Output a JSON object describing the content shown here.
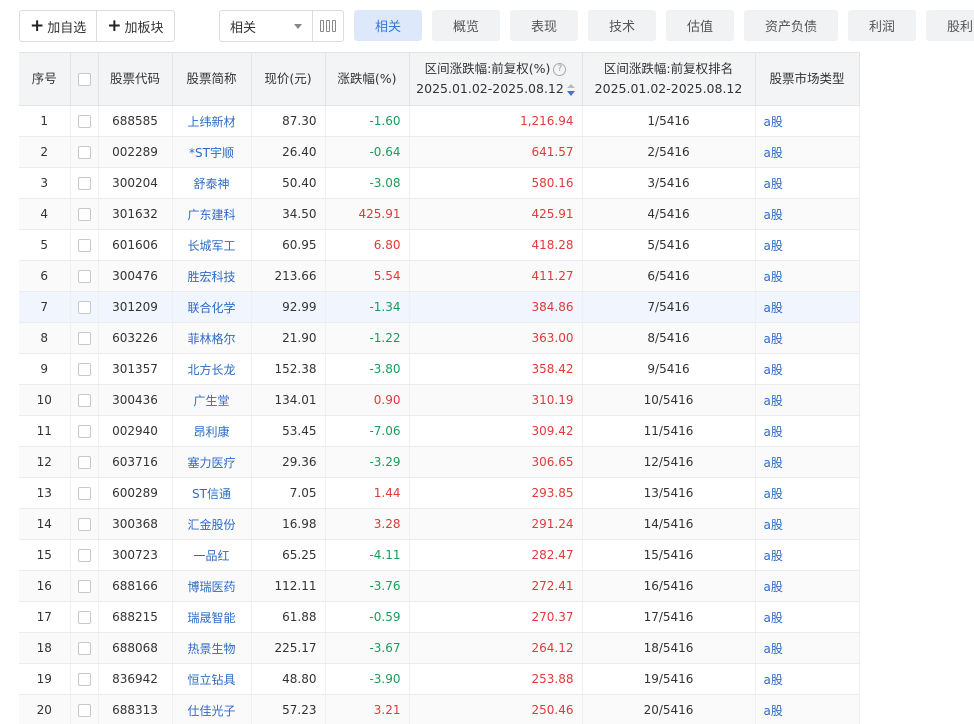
{
  "toolbar": {
    "add_watch_label": "加自选",
    "add_sector_label": "加板块",
    "select_value": "相关",
    "tabs": [
      {
        "label": "相关",
        "active": true
      },
      {
        "label": "概览",
        "active": false
      },
      {
        "label": "表现",
        "active": false
      },
      {
        "label": "技术",
        "active": false
      },
      {
        "label": "估值",
        "active": false
      },
      {
        "label": "资产负债",
        "active": false
      },
      {
        "label": "利润",
        "active": false
      },
      {
        "label": "股利",
        "active": false
      }
    ]
  },
  "table": {
    "headers": {
      "idx": "序号",
      "code": "股票代码",
      "name": "股票简称",
      "price": "现价(元)",
      "chg": "涨跌幅(%)",
      "range_line1": "区间涨跌幅:前复权(%)",
      "range_line2": "2025.01.02-2025.08.12",
      "rank_line1": "区间涨跌幅:前复权排名",
      "rank_line2": "2025.01.02-2025.08.12",
      "market": "股票市场类型"
    },
    "rows": [
      {
        "idx": "1",
        "code": "688585",
        "name": "上纬新材",
        "price": "87.30",
        "chg": "-1.60",
        "dir": "down",
        "range": "1,216.94",
        "rank": "1/5416",
        "market": "a股"
      },
      {
        "idx": "2",
        "code": "002289",
        "name": "*ST宇顺",
        "price": "26.40",
        "chg": "-0.64",
        "dir": "down",
        "range": "641.57",
        "rank": "2/5416",
        "market": "a股"
      },
      {
        "idx": "3",
        "code": "300204",
        "name": "舒泰神",
        "price": "50.40",
        "chg": "-3.08",
        "dir": "down",
        "range": "580.16",
        "rank": "3/5416",
        "market": "a股"
      },
      {
        "idx": "4",
        "code": "301632",
        "name": "广东建科",
        "price": "34.50",
        "chg": "425.91",
        "dir": "up",
        "range": "425.91",
        "rank": "4/5416",
        "market": "a股"
      },
      {
        "idx": "5",
        "code": "601606",
        "name": "长城军工",
        "price": "60.95",
        "chg": "6.80",
        "dir": "up",
        "range": "418.28",
        "rank": "5/5416",
        "market": "a股"
      },
      {
        "idx": "6",
        "code": "300476",
        "name": "胜宏科技",
        "price": "213.66",
        "chg": "5.54",
        "dir": "up",
        "range": "411.27",
        "rank": "6/5416",
        "market": "a股"
      },
      {
        "idx": "7",
        "code": "301209",
        "name": "联合化学",
        "price": "92.99",
        "chg": "-1.34",
        "dir": "down",
        "range": "384.86",
        "rank": "7/5416",
        "market": "a股"
      },
      {
        "idx": "8",
        "code": "603226",
        "name": "菲林格尔",
        "price": "21.90",
        "chg": "-1.22",
        "dir": "down",
        "range": "363.00",
        "rank": "8/5416",
        "market": "a股"
      },
      {
        "idx": "9",
        "code": "301357",
        "name": "北方长龙",
        "price": "152.38",
        "chg": "-3.80",
        "dir": "down",
        "range": "358.42",
        "rank": "9/5416",
        "market": "a股"
      },
      {
        "idx": "10",
        "code": "300436",
        "name": "广生堂",
        "price": "134.01",
        "chg": "0.90",
        "dir": "up",
        "range": "310.19",
        "rank": "10/5416",
        "market": "a股"
      },
      {
        "idx": "11",
        "code": "002940",
        "name": "昂利康",
        "price": "53.45",
        "chg": "-7.06",
        "dir": "down",
        "range": "309.42",
        "rank": "11/5416",
        "market": "a股"
      },
      {
        "idx": "12",
        "code": "603716",
        "name": "塞力医疗",
        "price": "29.36",
        "chg": "-3.29",
        "dir": "down",
        "range": "306.65",
        "rank": "12/5416",
        "market": "a股"
      },
      {
        "idx": "13",
        "code": "600289",
        "name": "ST信通",
        "price": "7.05",
        "chg": "1.44",
        "dir": "up",
        "range": "293.85",
        "rank": "13/5416",
        "market": "a股"
      },
      {
        "idx": "14",
        "code": "300368",
        "name": "汇金股份",
        "price": "16.98",
        "chg": "3.28",
        "dir": "up",
        "range": "291.24",
        "rank": "14/5416",
        "market": "a股"
      },
      {
        "idx": "15",
        "code": "300723",
        "name": "一品红",
        "price": "65.25",
        "chg": "-4.11",
        "dir": "down",
        "range": "282.47",
        "rank": "15/5416",
        "market": "a股"
      },
      {
        "idx": "16",
        "code": "688166",
        "name": "博瑞医药",
        "price": "112.11",
        "chg": "-3.76",
        "dir": "down",
        "range": "272.41",
        "rank": "16/5416",
        "market": "a股"
      },
      {
        "idx": "17",
        "code": "688215",
        "name": "瑞晟智能",
        "price": "61.88",
        "chg": "-0.59",
        "dir": "down",
        "range": "270.37",
        "rank": "17/5416",
        "market": "a股"
      },
      {
        "idx": "18",
        "code": "688068",
        "name": "热景生物",
        "price": "225.17",
        "chg": "-3.67",
        "dir": "down",
        "range": "264.12",
        "rank": "18/5416",
        "market": "a股"
      },
      {
        "idx": "19",
        "code": "836942",
        "name": "恒立钻具",
        "price": "48.80",
        "chg": "-3.90",
        "dir": "down",
        "range": "253.88",
        "rank": "19/5416",
        "market": "a股"
      },
      {
        "idx": "20",
        "code": "688313",
        "name": "仕佳光子",
        "price": "57.23",
        "chg": "3.21",
        "dir": "up",
        "range": "250.46",
        "rank": "20/5416",
        "market": "a股"
      }
    ],
    "highlighted_row": "7"
  },
  "colors": {
    "up": "#e03a3a",
    "down": "#1a9c5a",
    "link": "#2e6bc6",
    "accent": "#3a78d8"
  }
}
